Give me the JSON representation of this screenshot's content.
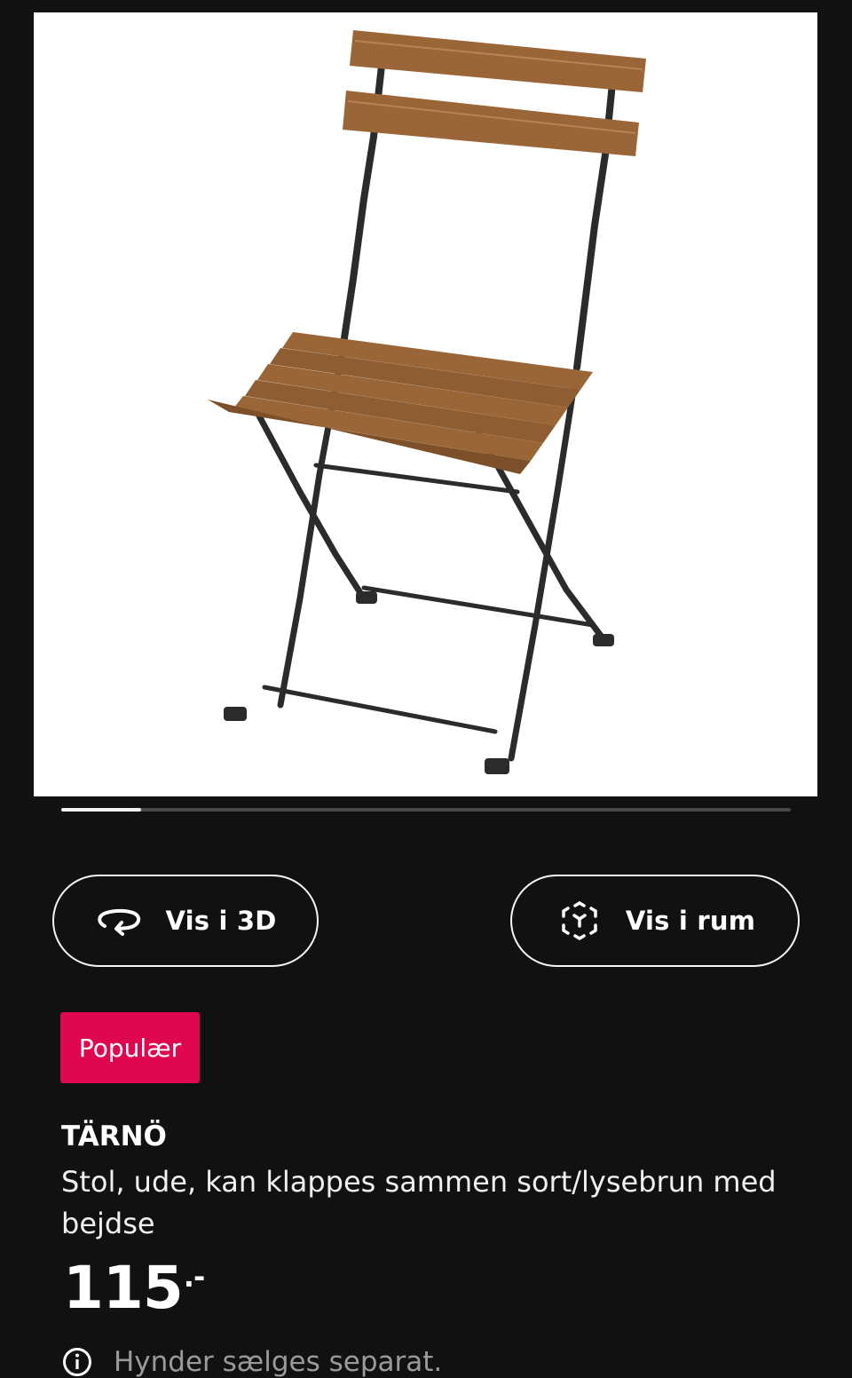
{
  "product_image": {
    "icon": "folding-chair-image"
  },
  "carousel": {
    "progress": 0.11
  },
  "buttons": {
    "view_3d": {
      "label": "Vis i 3D",
      "icon": "rotate-3d-icon"
    },
    "view_room": {
      "label": "Vis i rum",
      "icon": "ar-cube-icon"
    }
  },
  "badge": {
    "label": "Populær",
    "color": "#e00751"
  },
  "product": {
    "name": "TÄRNÖ",
    "description": "Stol, ude, kan klappes sammen sort/lysebrun med bejdse",
    "price_main": "115",
    "price_suffix": ".-"
  },
  "info": {
    "text": "Hynder sælges separat.",
    "icon": "info-icon"
  }
}
